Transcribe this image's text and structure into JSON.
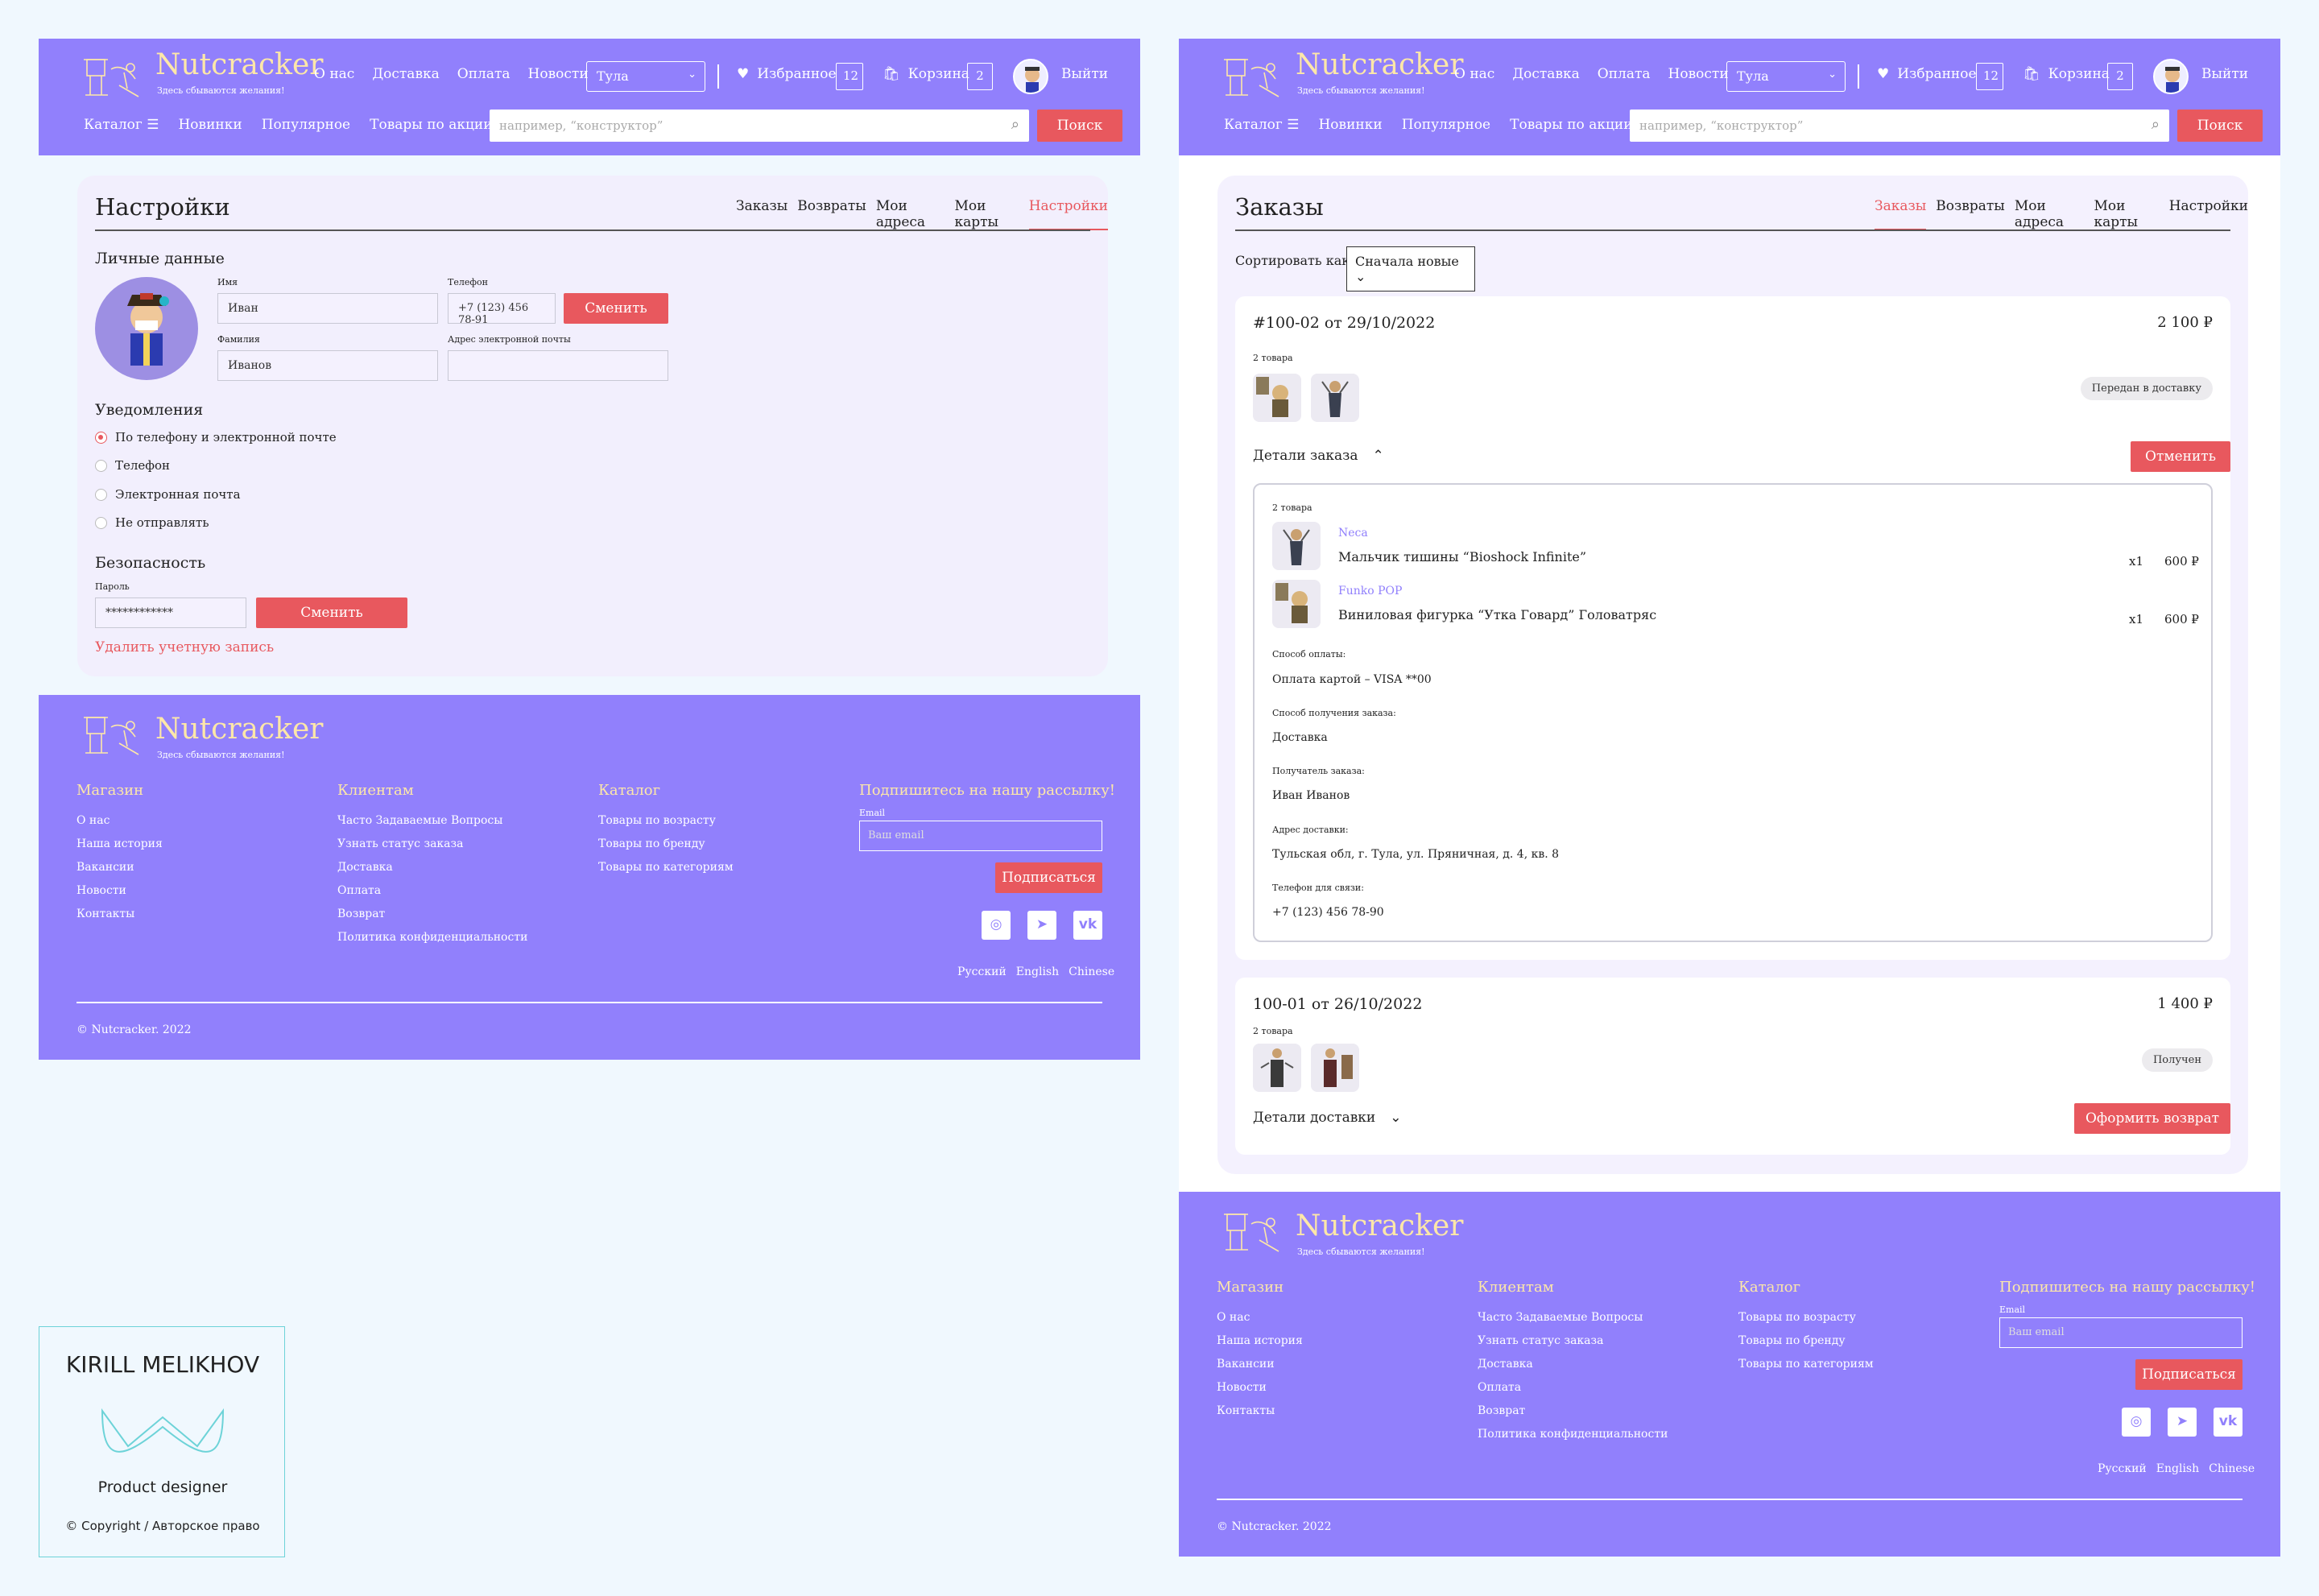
{
  "header": {
    "brand": "Nutcracker",
    "tagline": "Здесь сбываются желания!",
    "nav": [
      "О нас",
      "Доставка",
      "Оплата",
      "Новости"
    ],
    "city": "Тула",
    "favorites_label": "Избранное",
    "favorites_count": "12",
    "cart_label": "Корзина",
    "cart_count": "2",
    "logout": "Выйти",
    "catalog": "Каталог",
    "subnav": [
      "Новинки",
      "Популярное",
      "Товары по акции %"
    ],
    "search_placeholder": "например, “конструктор”",
    "search_button": "Поиск"
  },
  "settings": {
    "title": "Настройки",
    "tabs": [
      "Заказы",
      "Возвраты",
      "Мои адреса",
      "Мои карты",
      "Настройки"
    ],
    "personal_title": "Личные данные",
    "name_label": "Имя",
    "name_value": "Иван",
    "phone_label": "Телефон",
    "phone_value": "+7 (123) 456 78-91",
    "change_button": "Сменить",
    "surname_label": "Фамилия",
    "surname_value": "Иванов",
    "email_label": "Адрес электронной почты",
    "email_value": "",
    "notifications_title": "Уведомления",
    "notification_options": [
      "По телефону и электронной почте",
      "Телефон",
      "Электронная почта",
      "Не отправлять"
    ],
    "security_title": "Безопасность",
    "password_label": "Пароль",
    "password_value": "************",
    "password_button": "Сменить",
    "delete_account": "Удалить учетную запись"
  },
  "orders": {
    "title": "Заказы",
    "tabs": [
      "Заказы",
      "Возвраты",
      "Мои адреса",
      "Мои карты",
      "Настройки"
    ],
    "sort_label": "Сортировать как:",
    "sort_value": "Сначала новые",
    "order1": {
      "number": "#100-02 от 29/10/2022",
      "price": "2 100 ₽",
      "count": "2 товара",
      "status": "Передан в доставку",
      "details": "Детали заказа",
      "cancel": "Отменить",
      "inner_count": "2 товара",
      "items": [
        {
          "brand": "Neca",
          "name": "Мальчик тишины “Bioshock Infinite”",
          "qty": "x1",
          "price": "600 ₽"
        },
        {
          "brand": "Funko POP",
          "name": "Виниловая фигурка “Утка Говард” Головатряс",
          "qty": "x1",
          "price": "600 ₽"
        }
      ],
      "payment_label": "Способ оплаты:",
      "payment_value": "Оплата картой – VISA **00",
      "delivery_label": "Способ получения заказа:",
      "delivery_value": "Доставка",
      "recipient_label": "Получатель заказа:",
      "recipient_value": "Иван Иванов",
      "address_label": "Адрес доставки:",
      "address_value": "Тульская обл, г. Тула, ул. Пряничная, д. 4, кв. 8",
      "phone_label": "Телефон для связи:",
      "phone_value": "+7 (123) 456 78-90"
    },
    "order2": {
      "number": "100-01 от 26/10/2022",
      "price": "1 400 ₽",
      "count": "2 товара",
      "status": "Получен",
      "details": "Детали доставки",
      "return": "Оформить возврат"
    }
  },
  "footer": {
    "brand": "Nutcracker",
    "tagline": "Здесь сбываются желания!",
    "col1_title": "Магазин",
    "col1": [
      "О нас",
      "Наша история",
      "Вакансии",
      "Новости",
      "Контакты"
    ],
    "col2_title": "Клиентам",
    "col2": [
      "Часто Задаваемые Вопросы",
      "Узнать статус заказа",
      "Доставка",
      "Оплата",
      "Возврат",
      "Политика конфиденциальности"
    ],
    "col3_title": "Каталог",
    "col3": [
      "Товары по возрасту",
      "Товары по бренду",
      "Товары по категориям"
    ],
    "subscribe_title": "Подпишитесь на нашу рассылку!",
    "email_label": "Email",
    "email_placeholder": "Ваш email",
    "subscribe_button": "Подписаться",
    "languages": [
      "Русский",
      "English",
      "Chinese"
    ],
    "copyright": "© Nutcracker. 2022",
    "social": [
      "instagram-icon",
      "telegram-icon",
      "vk-icon"
    ]
  },
  "credit": {
    "name": "KIRILL MELIKHOV",
    "role": "Product designer",
    "copyright": "© Copyright / Авторское право"
  },
  "colors": {
    "brand": "#9180fc",
    "accent": "#e8585e",
    "brand_text": "#fde7a8"
  }
}
